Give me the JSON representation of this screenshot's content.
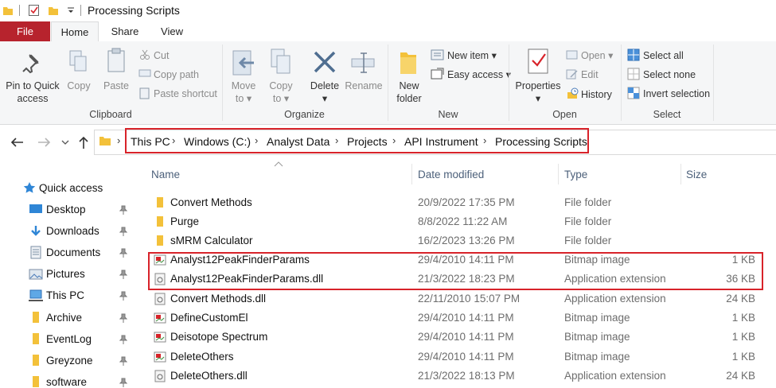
{
  "window": {
    "title": "Processing Scripts"
  },
  "tabs": [
    {
      "label": "File"
    },
    {
      "label": "Home"
    },
    {
      "label": "Share"
    },
    {
      "label": "View"
    }
  ],
  "ribbon": {
    "clipboard": {
      "label": "Clipboard",
      "pin_line1": "Pin to Quick",
      "pin_line2": "access",
      "copy": "Copy",
      "paste": "Paste",
      "cut": "Cut",
      "copy_path": "Copy path",
      "paste_shortcut": "Paste shortcut"
    },
    "organize": {
      "label": "Organize",
      "move_line1": "Move",
      "move_line2": "to",
      "copy_line1": "Copy",
      "copy_line2": "to",
      "delete": "Delete",
      "rename": "Rename"
    },
    "new": {
      "label": "New",
      "new_folder_line1": "New",
      "new_folder_line2": "folder",
      "new_item": "New item",
      "easy_access": "Easy access"
    },
    "open": {
      "label": "Open",
      "properties": "Properties",
      "open": "Open",
      "edit": "Edit",
      "history": "History"
    },
    "select": {
      "label": "Select",
      "select_all": "Select all",
      "select_none": "Select none",
      "invert_selection": "Invert selection"
    }
  },
  "address": {
    "crumbs": [
      "This PC",
      "Windows (C:)",
      "Analyst Data",
      "Projects",
      "API Instrument",
      "Processing Scripts"
    ]
  },
  "columns": {
    "name": "Name",
    "date": "Date modified",
    "type": "Type",
    "size": "Size"
  },
  "nav": [
    {
      "label": "Quick access",
      "icon": "star-icon"
    },
    {
      "label": "Desktop",
      "icon": "desktop-icon"
    },
    {
      "label": "Downloads",
      "icon": "download-icon"
    },
    {
      "label": "Documents",
      "icon": "documents-icon"
    },
    {
      "label": "Pictures",
      "icon": "pictures-icon"
    },
    {
      "label": "This PC",
      "icon": "computer-icon"
    },
    {
      "label": "Archive",
      "icon": "folder-icon"
    },
    {
      "label": "EventLog",
      "icon": "folder-icon"
    },
    {
      "label": "Greyzone",
      "icon": "folder-icon"
    },
    {
      "label": "software",
      "icon": "folder-icon"
    }
  ],
  "files": [
    {
      "name": "Convert Methods",
      "date": "20/9/2022 17:35 PM",
      "type": "File folder",
      "size": "",
      "icon": "folder-icon"
    },
    {
      "name": "Purge",
      "date": "8/8/2022 11:22 AM",
      "type": "File folder",
      "size": "",
      "icon": "folder-icon"
    },
    {
      "name": "sMRM Calculator",
      "date": "16/2/2023 13:26 PM",
      "type": "File folder",
      "size": "",
      "icon": "folder-icon"
    },
    {
      "name": "Analyst12PeakFinderParams",
      "date": "29/4/2010 14:11 PM",
      "type": "Bitmap image",
      "size": "1 KB",
      "icon": "bitmap-icon"
    },
    {
      "name": "Analyst12PeakFinderParams.dll",
      "date": "21/3/2022 18:23 PM",
      "type": "Application extension",
      "size": "36 KB",
      "icon": "dll-icon"
    },
    {
      "name": "Convert Methods.dll",
      "date": "22/11/2010 15:07 PM",
      "type": "Application extension",
      "size": "24 KB",
      "icon": "dll-icon"
    },
    {
      "name": "DefineCustomEl",
      "date": "29/4/2010 14:11 PM",
      "type": "Bitmap image",
      "size": "1 KB",
      "icon": "bitmap-icon"
    },
    {
      "name": "Deisotope Spectrum",
      "date": "29/4/2010 14:11 PM",
      "type": "Bitmap image",
      "size": "1 KB",
      "icon": "bitmap-icon"
    },
    {
      "name": "DeleteOthers",
      "date": "29/4/2010 14:11 PM",
      "type": "Bitmap image",
      "size": "1 KB",
      "icon": "bitmap-icon"
    },
    {
      "name": "DeleteOthers.dll",
      "date": "21/3/2022 18:13 PM",
      "type": "Application extension",
      "size": "24 KB",
      "icon": "dll-icon"
    }
  ],
  "colors": {
    "file_tab": "#b7232d",
    "highlight": "#d8232a",
    "folder": "#f3c13a"
  }
}
